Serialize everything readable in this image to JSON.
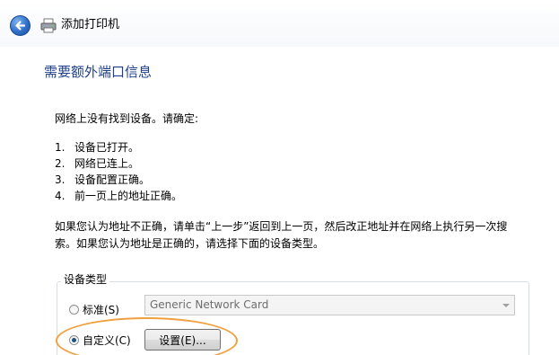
{
  "header": {
    "back_icon": "back-arrow-icon",
    "printer_icon": "printer-icon",
    "title": "添加打印机"
  },
  "main": {
    "heading": "需要额外端口信息",
    "intro": "网络上没有找到设备。请确定:",
    "checklist": [
      {
        "num": "1.",
        "text": "设备已打开。"
      },
      {
        "num": "2.",
        "text": "网络已连上。"
      },
      {
        "num": "3.",
        "text": "设备配置正确。"
      },
      {
        "num": "4.",
        "text": "前一页上的地址正确。"
      }
    ],
    "explain_line1": "如果您认为地址不正确，请单击“上一步”返回到上一页，然后改正地址并在网络上执行另一次搜",
    "explain_line2": "索。如果您认为地址是正确的，请选择下面的设备类型。"
  },
  "device_type": {
    "group_label": "设备类型",
    "standard": {
      "label": "标准(S)",
      "checked": false,
      "selected_value": "Generic Network Card"
    },
    "custom": {
      "label": "自定义(C)",
      "checked": true,
      "settings_button": "设置(E)..."
    }
  },
  "colors": {
    "heading": "#1e3f8c",
    "highlight": "#f0a040"
  }
}
